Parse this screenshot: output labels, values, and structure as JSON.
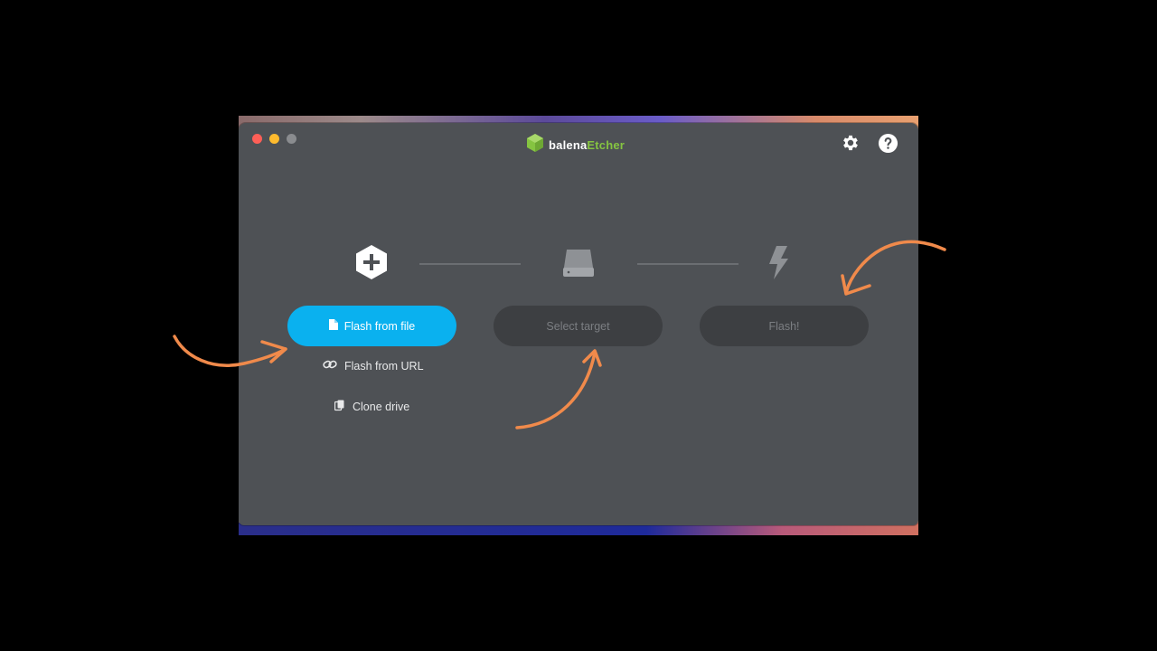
{
  "app": {
    "logo_part1": "balena",
    "logo_part2": "Etcher"
  },
  "header": {
    "settings_icon": "gear-icon",
    "help_icon": "question-mark-icon"
  },
  "steps": [
    {
      "icon": "plus-hexagon-icon"
    },
    {
      "icon": "drive-icon"
    },
    {
      "icon": "lightning-icon"
    }
  ],
  "buttons": {
    "flash_from_file": "Flash from file",
    "select_target": "Select target",
    "flash": "Flash!"
  },
  "links": {
    "flash_from_url": "Flash from URL",
    "clone_drive": "Clone drive"
  },
  "colors": {
    "window_bg": "#4e5155",
    "primary_button": "#0ab1ef",
    "disabled_button": "#3d3f42",
    "brand_green": "#85c441",
    "annotation_arrow": "#f08a4b"
  }
}
